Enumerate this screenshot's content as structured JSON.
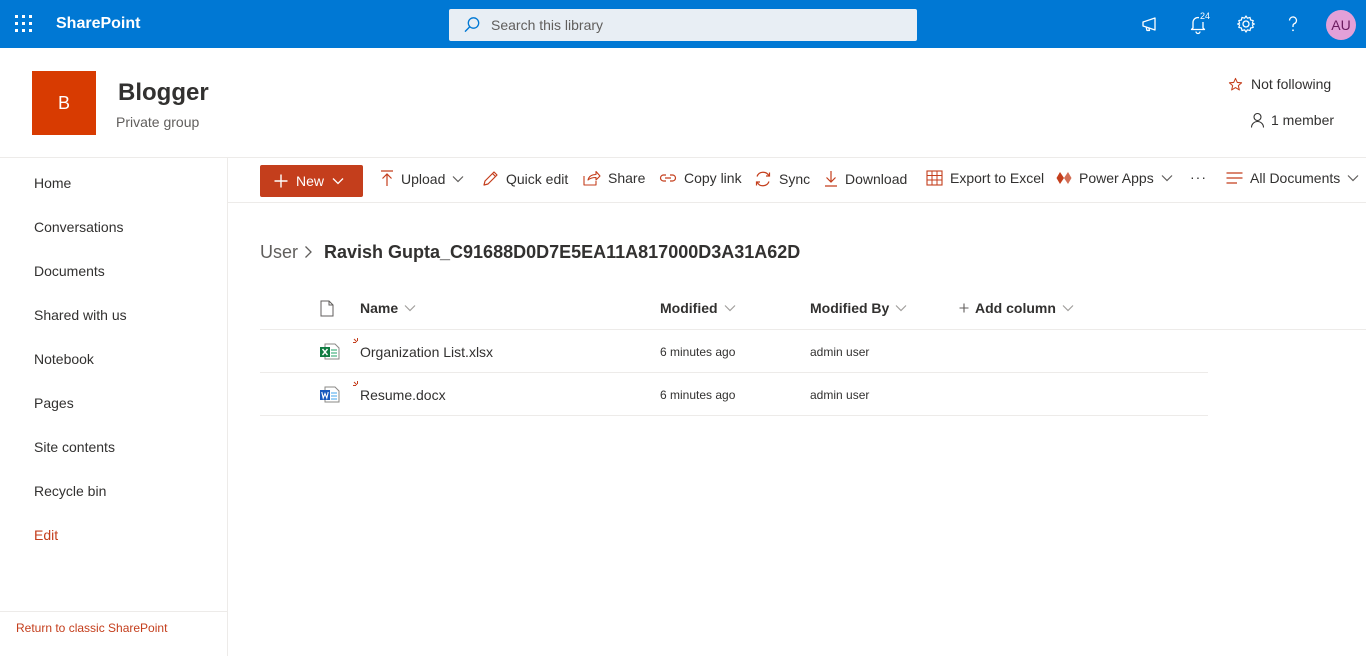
{
  "suite": {
    "brand": "SharePoint",
    "search_placeholder": "Search this library",
    "notification_count": "24",
    "avatar_initials": "AU"
  },
  "site": {
    "logo_letter": "B",
    "title": "Blogger",
    "subtitle": "Private group",
    "follow_label": "Not following",
    "members_label": "1 member"
  },
  "nav": {
    "items": [
      "Home",
      "Conversations",
      "Documents",
      "Shared with us",
      "Notebook",
      "Pages",
      "Site contents",
      "Recycle bin"
    ],
    "edit": "Edit",
    "classic": "Return to classic SharePoint"
  },
  "commands": {
    "new": "New",
    "upload": "Upload",
    "quick_edit": "Quick edit",
    "share": "Share",
    "copy_link": "Copy link",
    "sync": "Sync",
    "download": "Download",
    "export": "Export to Excel",
    "power_apps": "Power Apps",
    "more": "···",
    "view": "All Documents"
  },
  "breadcrumb": {
    "root": "User",
    "current": "Ravish Gupta_C91688D0D7E5EA11A817000D3A31A62D"
  },
  "list": {
    "columns": {
      "name": "Name",
      "modified": "Modified",
      "modified_by": "Modified By",
      "add_column": "Add column"
    },
    "rows": [
      {
        "name": "Organization List.xlsx",
        "modified": "6 minutes ago",
        "modified_by": "admin user",
        "type": "excel-file-icon"
      },
      {
        "name": "Resume.docx",
        "modified": "6 minutes ago",
        "modified_by": "admin user",
        "type": "word-file-icon"
      }
    ]
  },
  "colors": {
    "suite_bar": "#0078d4",
    "accent": "#c43e1c",
    "site_logo": "#d83b01"
  }
}
